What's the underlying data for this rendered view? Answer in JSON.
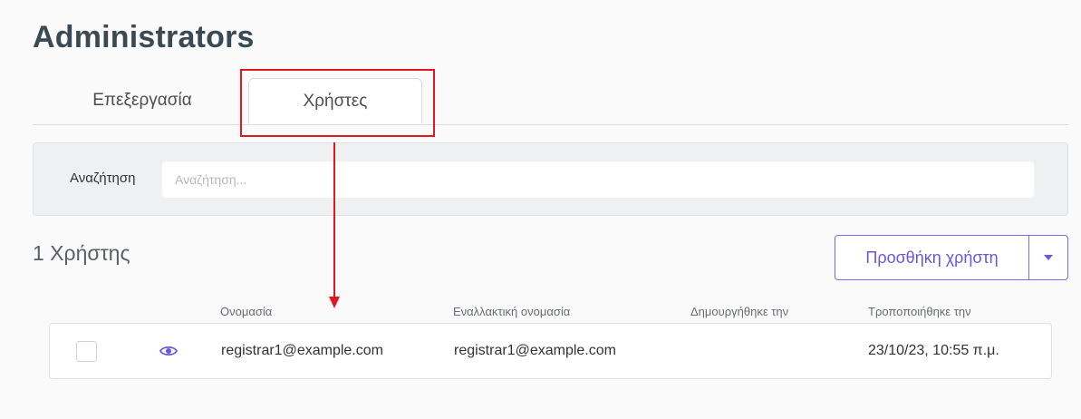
{
  "page": {
    "title": "Administrators"
  },
  "tabs": [
    {
      "label": "Επεξεργασία",
      "active": false
    },
    {
      "label": "Χρήστες",
      "active": true
    }
  ],
  "search": {
    "label": "Αναζήτηση",
    "placeholder": "Αναζήτηση...",
    "value": ""
  },
  "users": {
    "count_label": "1 Χρήστης",
    "add_button_label": "Προσθήκη χρήστη",
    "columns": {
      "name": "Ονομασία",
      "alt_name": "Εναλλακτική ονομασία",
      "created": "Δημουργήθηκε την",
      "modified": "Τροποποιήθηκε την"
    },
    "rows": [
      {
        "checked": false,
        "name": "registrar1@example.com",
        "alt_name": "registrar1@example.com",
        "created": "",
        "modified": "23/10/23, 10:55 π.μ."
      }
    ]
  },
  "icons": {
    "view": "eye-icon",
    "dropdown": "chevron-down-icon"
  },
  "colors": {
    "accent": "#6a56e0",
    "annotation": "#e0191e"
  }
}
